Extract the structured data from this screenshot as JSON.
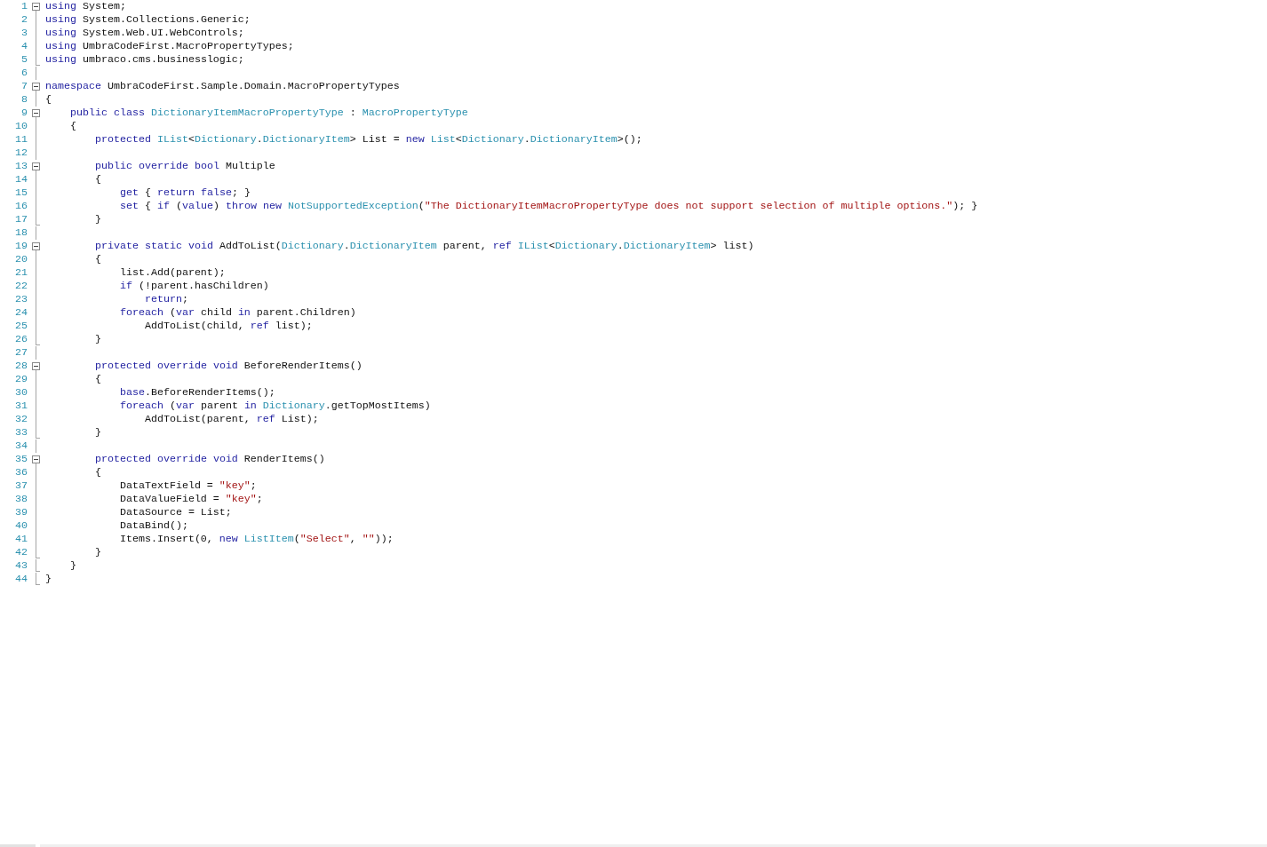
{
  "editor": {
    "lines": [
      {
        "number": "1",
        "fold_start": true,
        "fold_end": false,
        "tokens": [
          {
            "kind": "keyword",
            "text": "using"
          },
          {
            "kind": "plain",
            "text": " System;"
          }
        ]
      },
      {
        "number": "2",
        "fold_start": false,
        "fold_end": false,
        "tokens": [
          {
            "kind": "keyword",
            "text": "using"
          },
          {
            "kind": "plain",
            "text": " System.Collections.Generic;"
          }
        ]
      },
      {
        "number": "3",
        "fold_start": false,
        "fold_end": false,
        "tokens": [
          {
            "kind": "keyword",
            "text": "using"
          },
          {
            "kind": "plain",
            "text": " System.Web.UI.WebControls;"
          }
        ]
      },
      {
        "number": "4",
        "fold_start": false,
        "fold_end": false,
        "tokens": [
          {
            "kind": "keyword",
            "text": "using"
          },
          {
            "kind": "plain",
            "text": " UmbraCodeFirst.MacroPropertyTypes;"
          }
        ]
      },
      {
        "number": "5",
        "fold_start": false,
        "fold_end": true,
        "tokens": [
          {
            "kind": "keyword",
            "text": "using"
          },
          {
            "kind": "plain",
            "text": " umbraco.cms.businesslogic;"
          }
        ]
      },
      {
        "number": "6",
        "fold_start": false,
        "fold_end": false
      },
      {
        "number": "7",
        "fold_start": true,
        "fold_end": false,
        "tokens": [
          {
            "kind": "keyword",
            "text": "namespace"
          },
          {
            "kind": "plain",
            "text": " UmbraCodeFirst.Sample.Domain.MacroPropertyTypes"
          }
        ]
      },
      {
        "number": "8",
        "fold_start": false,
        "fold_end": false,
        "tokens": [
          {
            "kind": "plain",
            "text": "{"
          }
        ]
      },
      {
        "number": "9",
        "fold_start": true,
        "fold_end": false,
        "tokens": [
          {
            "kind": "keyword",
            "text": "    public"
          },
          {
            "kind": "keyword",
            "text": " class"
          },
          {
            "kind": "type",
            "text": " DictionaryItemMacroPropertyType"
          },
          {
            "kind": "plain",
            "text": " : "
          },
          {
            "kind": "type",
            "text": "MacroPropertyType"
          }
        ]
      },
      {
        "number": "10",
        "fold_start": false,
        "fold_end": false,
        "tokens": [
          {
            "kind": "plain",
            "text": "    {"
          }
        ]
      },
      {
        "number": "11",
        "fold_start": false,
        "fold_end": false,
        "tokens": [
          {
            "kind": "keyword",
            "text": "        protected"
          },
          {
            "kind": "type",
            "text": " IList"
          },
          {
            "kind": "plain",
            "text": "<"
          },
          {
            "kind": "type",
            "text": "Dictionary"
          },
          {
            "kind": "plain",
            "text": "."
          },
          {
            "kind": "type",
            "text": "DictionaryItem"
          },
          {
            "kind": "plain",
            "text": "> List = "
          },
          {
            "kind": "keyword",
            "text": "new"
          },
          {
            "kind": "type",
            "text": " List"
          },
          {
            "kind": "plain",
            "text": "<"
          },
          {
            "kind": "type",
            "text": "Dictionary"
          },
          {
            "kind": "plain",
            "text": "."
          },
          {
            "kind": "type",
            "text": "DictionaryItem"
          },
          {
            "kind": "plain",
            "text": ">();"
          }
        ]
      },
      {
        "number": "12",
        "fold_start": false,
        "fold_end": false
      },
      {
        "number": "13",
        "fold_start": true,
        "fold_end": false,
        "tokens": [
          {
            "kind": "keyword",
            "text": "        public"
          },
          {
            "kind": "keyword",
            "text": " override"
          },
          {
            "kind": "keyword",
            "text": " bool"
          },
          {
            "kind": "plain",
            "text": " Multiple"
          }
        ]
      },
      {
        "number": "14",
        "fold_start": false,
        "fold_end": false,
        "tokens": [
          {
            "kind": "plain",
            "text": "        {"
          }
        ]
      },
      {
        "number": "15",
        "fold_start": false,
        "fold_end": false,
        "tokens": [
          {
            "kind": "keyword",
            "text": "            get"
          },
          {
            "kind": "plain",
            "text": " { "
          },
          {
            "kind": "keyword",
            "text": "return"
          },
          {
            "kind": "keyword",
            "text": " false"
          },
          {
            "kind": "plain",
            "text": "; }"
          }
        ]
      },
      {
        "number": "16",
        "fold_start": false,
        "fold_end": false,
        "tokens": [
          {
            "kind": "keyword",
            "text": "            set"
          },
          {
            "kind": "plain",
            "text": " { "
          },
          {
            "kind": "keyword",
            "text": "if"
          },
          {
            "kind": "plain",
            "text": " ("
          },
          {
            "kind": "keyword",
            "text": "value"
          },
          {
            "kind": "plain",
            "text": ") "
          },
          {
            "kind": "keyword",
            "text": "throw"
          },
          {
            "kind": "keyword",
            "text": " new"
          },
          {
            "kind": "type",
            "text": " NotSupportedException"
          },
          {
            "kind": "plain",
            "text": "("
          },
          {
            "kind": "string",
            "text": "\"The DictionaryItemMacroPropertyType does not support selection of multiple options.\""
          },
          {
            "kind": "plain",
            "text": "); }"
          }
        ]
      },
      {
        "number": "17",
        "fold_start": false,
        "fold_end": true,
        "tokens": [
          {
            "kind": "plain",
            "text": "        }"
          }
        ]
      },
      {
        "number": "18",
        "fold_start": false,
        "fold_end": false
      },
      {
        "number": "19",
        "fold_start": true,
        "fold_end": false,
        "tokens": [
          {
            "kind": "keyword",
            "text": "        private"
          },
          {
            "kind": "keyword",
            "text": " static"
          },
          {
            "kind": "keyword",
            "text": " void"
          },
          {
            "kind": "plain",
            "text": " AddToList("
          },
          {
            "kind": "type",
            "text": "Dictionary"
          },
          {
            "kind": "plain",
            "text": "."
          },
          {
            "kind": "type",
            "text": "DictionaryItem"
          },
          {
            "kind": "plain",
            "text": " parent, "
          },
          {
            "kind": "keyword",
            "text": "ref"
          },
          {
            "kind": "type",
            "text": " IList"
          },
          {
            "kind": "plain",
            "text": "<"
          },
          {
            "kind": "type",
            "text": "Dictionary"
          },
          {
            "kind": "plain",
            "text": "."
          },
          {
            "kind": "type",
            "text": "DictionaryItem"
          },
          {
            "kind": "plain",
            "text": "> list)"
          }
        ]
      },
      {
        "number": "20",
        "fold_start": false,
        "fold_end": false,
        "tokens": [
          {
            "kind": "plain",
            "text": "        {"
          }
        ]
      },
      {
        "number": "21",
        "fold_start": false,
        "fold_end": false,
        "tokens": [
          {
            "kind": "plain",
            "text": "            list.Add(parent);"
          }
        ]
      },
      {
        "number": "22",
        "fold_start": false,
        "fold_end": false,
        "tokens": [
          {
            "kind": "keyword",
            "text": "            if"
          },
          {
            "kind": "plain",
            "text": " (!parent.hasChildren)"
          }
        ]
      },
      {
        "number": "23",
        "fold_start": false,
        "fold_end": false,
        "tokens": [
          {
            "kind": "keyword",
            "text": "                return"
          },
          {
            "kind": "plain",
            "text": ";"
          }
        ]
      },
      {
        "number": "24",
        "fold_start": false,
        "fold_end": false,
        "tokens": [
          {
            "kind": "keyword",
            "text": "            foreach"
          },
          {
            "kind": "plain",
            "text": " ("
          },
          {
            "kind": "keyword",
            "text": "var"
          },
          {
            "kind": "plain",
            "text": " child "
          },
          {
            "kind": "keyword",
            "text": "in"
          },
          {
            "kind": "plain",
            "text": " parent.Children)"
          }
        ]
      },
      {
        "number": "25",
        "fold_start": false,
        "fold_end": false,
        "tokens": [
          {
            "kind": "plain",
            "text": "                AddToList(child, "
          },
          {
            "kind": "keyword",
            "text": "ref"
          },
          {
            "kind": "plain",
            "text": " list);"
          }
        ]
      },
      {
        "number": "26",
        "fold_start": false,
        "fold_end": true,
        "tokens": [
          {
            "kind": "plain",
            "text": "        }"
          }
        ]
      },
      {
        "number": "27",
        "fold_start": false,
        "fold_end": false
      },
      {
        "number": "28",
        "fold_start": true,
        "fold_end": false,
        "tokens": [
          {
            "kind": "keyword",
            "text": "        protected"
          },
          {
            "kind": "keyword",
            "text": " override"
          },
          {
            "kind": "keyword",
            "text": " void"
          },
          {
            "kind": "plain",
            "text": " BeforeRenderItems()"
          }
        ]
      },
      {
        "number": "29",
        "fold_start": false,
        "fold_end": false,
        "tokens": [
          {
            "kind": "plain",
            "text": "        {"
          }
        ]
      },
      {
        "number": "30",
        "fold_start": false,
        "fold_end": false,
        "tokens": [
          {
            "kind": "keyword",
            "text": "            base"
          },
          {
            "kind": "plain",
            "text": ".BeforeRenderItems();"
          }
        ]
      },
      {
        "number": "31",
        "fold_start": false,
        "fold_end": false,
        "tokens": [
          {
            "kind": "keyword",
            "text": "            foreach"
          },
          {
            "kind": "plain",
            "text": " ("
          },
          {
            "kind": "keyword",
            "text": "var"
          },
          {
            "kind": "plain",
            "text": " parent "
          },
          {
            "kind": "keyword",
            "text": "in"
          },
          {
            "kind": "type",
            "text": " Dictionary"
          },
          {
            "kind": "plain",
            "text": ".getTopMostItems)"
          }
        ]
      },
      {
        "number": "32",
        "fold_start": false,
        "fold_end": false,
        "tokens": [
          {
            "kind": "plain",
            "text": "                AddToList(parent, "
          },
          {
            "kind": "keyword",
            "text": "ref"
          },
          {
            "kind": "plain",
            "text": " List);"
          }
        ]
      },
      {
        "number": "33",
        "fold_start": false,
        "fold_end": true,
        "tokens": [
          {
            "kind": "plain",
            "text": "        }"
          }
        ]
      },
      {
        "number": "34",
        "fold_start": false,
        "fold_end": false
      },
      {
        "number": "35",
        "fold_start": true,
        "fold_end": false,
        "tokens": [
          {
            "kind": "keyword",
            "text": "        protected"
          },
          {
            "kind": "keyword",
            "text": " override"
          },
          {
            "kind": "keyword",
            "text": " void"
          },
          {
            "kind": "plain",
            "text": " RenderItems()"
          }
        ]
      },
      {
        "number": "36",
        "fold_start": false,
        "fold_end": false,
        "tokens": [
          {
            "kind": "plain",
            "text": "        {"
          }
        ]
      },
      {
        "number": "37",
        "fold_start": false,
        "fold_end": false,
        "tokens": [
          {
            "kind": "plain",
            "text": "            DataTextField = "
          },
          {
            "kind": "string",
            "text": "\"key\""
          },
          {
            "kind": "plain",
            "text": ";"
          }
        ]
      },
      {
        "number": "38",
        "fold_start": false,
        "fold_end": false,
        "tokens": [
          {
            "kind": "plain",
            "text": "            DataValueField = "
          },
          {
            "kind": "string",
            "text": "\"key\""
          },
          {
            "kind": "plain",
            "text": ";"
          }
        ]
      },
      {
        "number": "39",
        "fold_start": false,
        "fold_end": false,
        "tokens": [
          {
            "kind": "plain",
            "text": "            DataSource = List;"
          }
        ]
      },
      {
        "number": "40",
        "fold_start": false,
        "fold_end": false,
        "tokens": [
          {
            "kind": "plain",
            "text": "            DataBind();"
          }
        ]
      },
      {
        "number": "41",
        "fold_start": false,
        "fold_end": false,
        "tokens": [
          {
            "kind": "plain",
            "text": "            Items.Insert(0, "
          },
          {
            "kind": "keyword",
            "text": "new"
          },
          {
            "kind": "type",
            "text": " ListItem"
          },
          {
            "kind": "plain",
            "text": "("
          },
          {
            "kind": "string",
            "text": "\"Select\""
          },
          {
            "kind": "plain",
            "text": ", "
          },
          {
            "kind": "string",
            "text": "\"\""
          },
          {
            "kind": "plain",
            "text": "));"
          }
        ]
      },
      {
        "number": "42",
        "fold_start": false,
        "fold_end": true,
        "tokens": [
          {
            "kind": "plain",
            "text": "        }"
          }
        ]
      },
      {
        "number": "43",
        "fold_start": false,
        "fold_end": true,
        "tokens": [
          {
            "kind": "plain",
            "text": "    }"
          }
        ]
      },
      {
        "number": "44",
        "fold_start": false,
        "fold_end": true,
        "tokens": [
          {
            "kind": "plain",
            "text": "}"
          }
        ]
      }
    ]
  }
}
